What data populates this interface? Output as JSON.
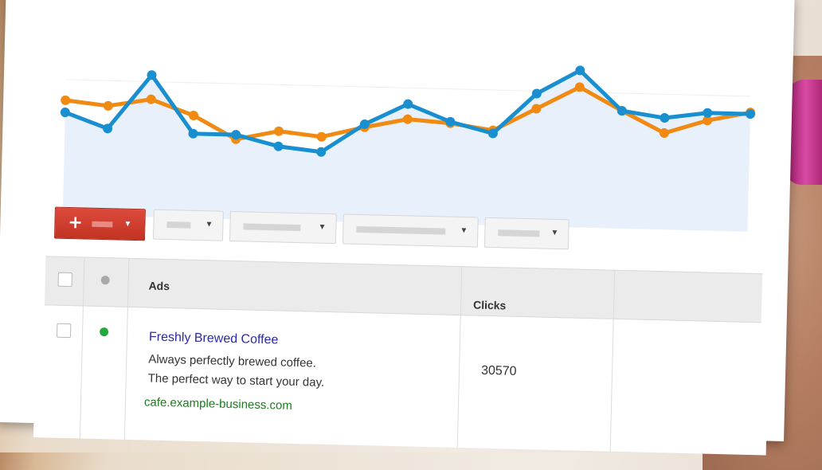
{
  "chart_data": {
    "type": "line",
    "x": [
      1,
      2,
      3,
      4,
      5,
      6,
      7,
      8,
      9,
      10,
      11,
      12,
      13,
      14,
      15,
      16,
      17
    ],
    "series": [
      {
        "color": "#1a8fd0",
        "values": [
          52,
          42,
          78,
          40,
          40,
          33,
          30,
          49,
          63,
          52,
          45,
          72,
          88,
          62,
          58,
          62,
          62
        ]
      },
      {
        "color": "#f08a12",
        "values": [
          60,
          57,
          62,
          52,
          37,
          43,
          40,
          47,
          53,
          51,
          47,
          62,
          77,
          62,
          48,
          57,
          63
        ]
      }
    ],
    "ylim": [
      0,
      100
    ],
    "fill_color": "#e8f1fb"
  },
  "toolbar": {
    "new_button_icon": "plus-icon",
    "dropdowns": [
      "",
      "",
      "",
      ""
    ]
  },
  "table": {
    "headers": {
      "ads": "Ads",
      "clicks": "Clicks"
    },
    "rows": [
      {
        "status_color": "#1faa3b",
        "title": "Freshly Brewed Coffee",
        "line1": "Always perfectly brewed coffee.",
        "line2": "The perfect way to start your day.",
        "url": "cafe.example-business.com",
        "clicks": "30570"
      }
    ]
  }
}
